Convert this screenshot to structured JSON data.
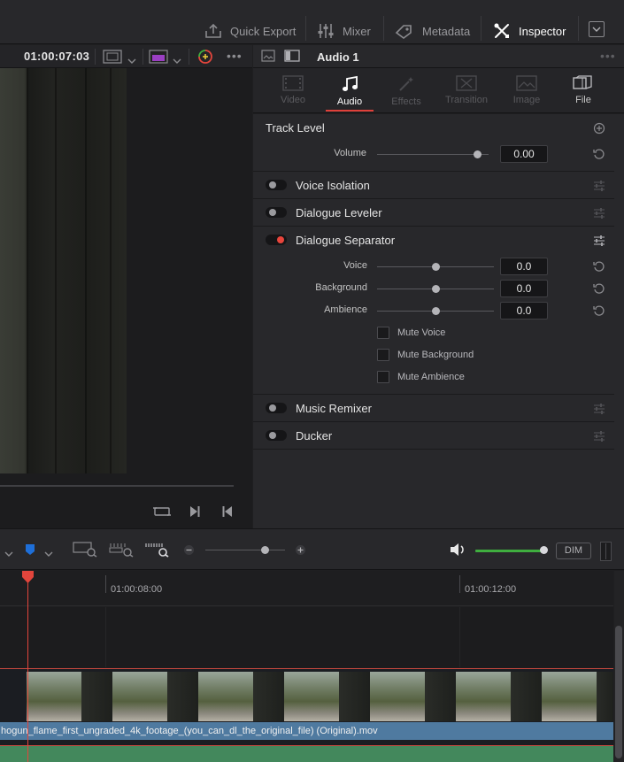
{
  "topbar": {
    "quick_export": "Quick Export",
    "mixer": "Mixer",
    "metadata": "Metadata",
    "inspector": "Inspector"
  },
  "viewer": {
    "timecode": "01:00:07:03"
  },
  "inspector": {
    "title": "Audio 1",
    "tabs": [
      {
        "label": "Video",
        "icon": "video-icon",
        "state": "disabled"
      },
      {
        "label": "Audio",
        "icon": "music-note-icon",
        "state": "active"
      },
      {
        "label": "Effects",
        "icon": "magic-wand-icon",
        "state": "disabled"
      },
      {
        "label": "Transition",
        "icon": "transition-icon",
        "state": "disabled"
      },
      {
        "label": "Image",
        "icon": "image-icon",
        "state": "disabled"
      },
      {
        "label": "File",
        "icon": "file-icon",
        "state": "enabled"
      }
    ],
    "track_level": {
      "title": "Track Level",
      "volume_label": "Volume",
      "volume_value": "0.00",
      "volume_level": 0.9
    },
    "voice_isolation": {
      "title": "Voice Isolation",
      "enabled": false
    },
    "dialogue_leveler": {
      "title": "Dialogue Leveler",
      "enabled": false
    },
    "dialogue_separator": {
      "title": "Dialogue Separator",
      "enabled": true,
      "params": [
        {
          "label": "Voice",
          "value": "0.0",
          "level": 0.5
        },
        {
          "label": "Background",
          "value": "0.0",
          "level": 0.5
        },
        {
          "label": "Ambience",
          "value": "0.0",
          "level": 0.5
        }
      ],
      "checkboxes": [
        {
          "label": "Mute Voice",
          "checked": false
        },
        {
          "label": "Mute Background",
          "checked": false
        },
        {
          "label": "Mute Ambience",
          "checked": false
        }
      ]
    },
    "music_remixer": {
      "title": "Music Remixer",
      "enabled": false
    },
    "ducker": {
      "title": "Ducker",
      "enabled": false
    }
  },
  "timeline_toolbar": {
    "zoom_level": 0.75,
    "monitor_volume_level": 0.95,
    "dim_label": "DIM",
    "colors": {
      "marker": "#1e6fd9",
      "volume_bar": "#3fae3f"
    }
  },
  "timeline": {
    "timecodes": [
      "01:00:08:00",
      "01:00:12:00"
    ],
    "clip_name": "hogun_flame_first_ungraded_4k_footage_(you_can_dl_the_original_file) (Original).mov",
    "colors": {
      "playhead": "#e2453c",
      "video_clip_label": "#4f7aa0",
      "audio_clip": "#43885c"
    }
  }
}
